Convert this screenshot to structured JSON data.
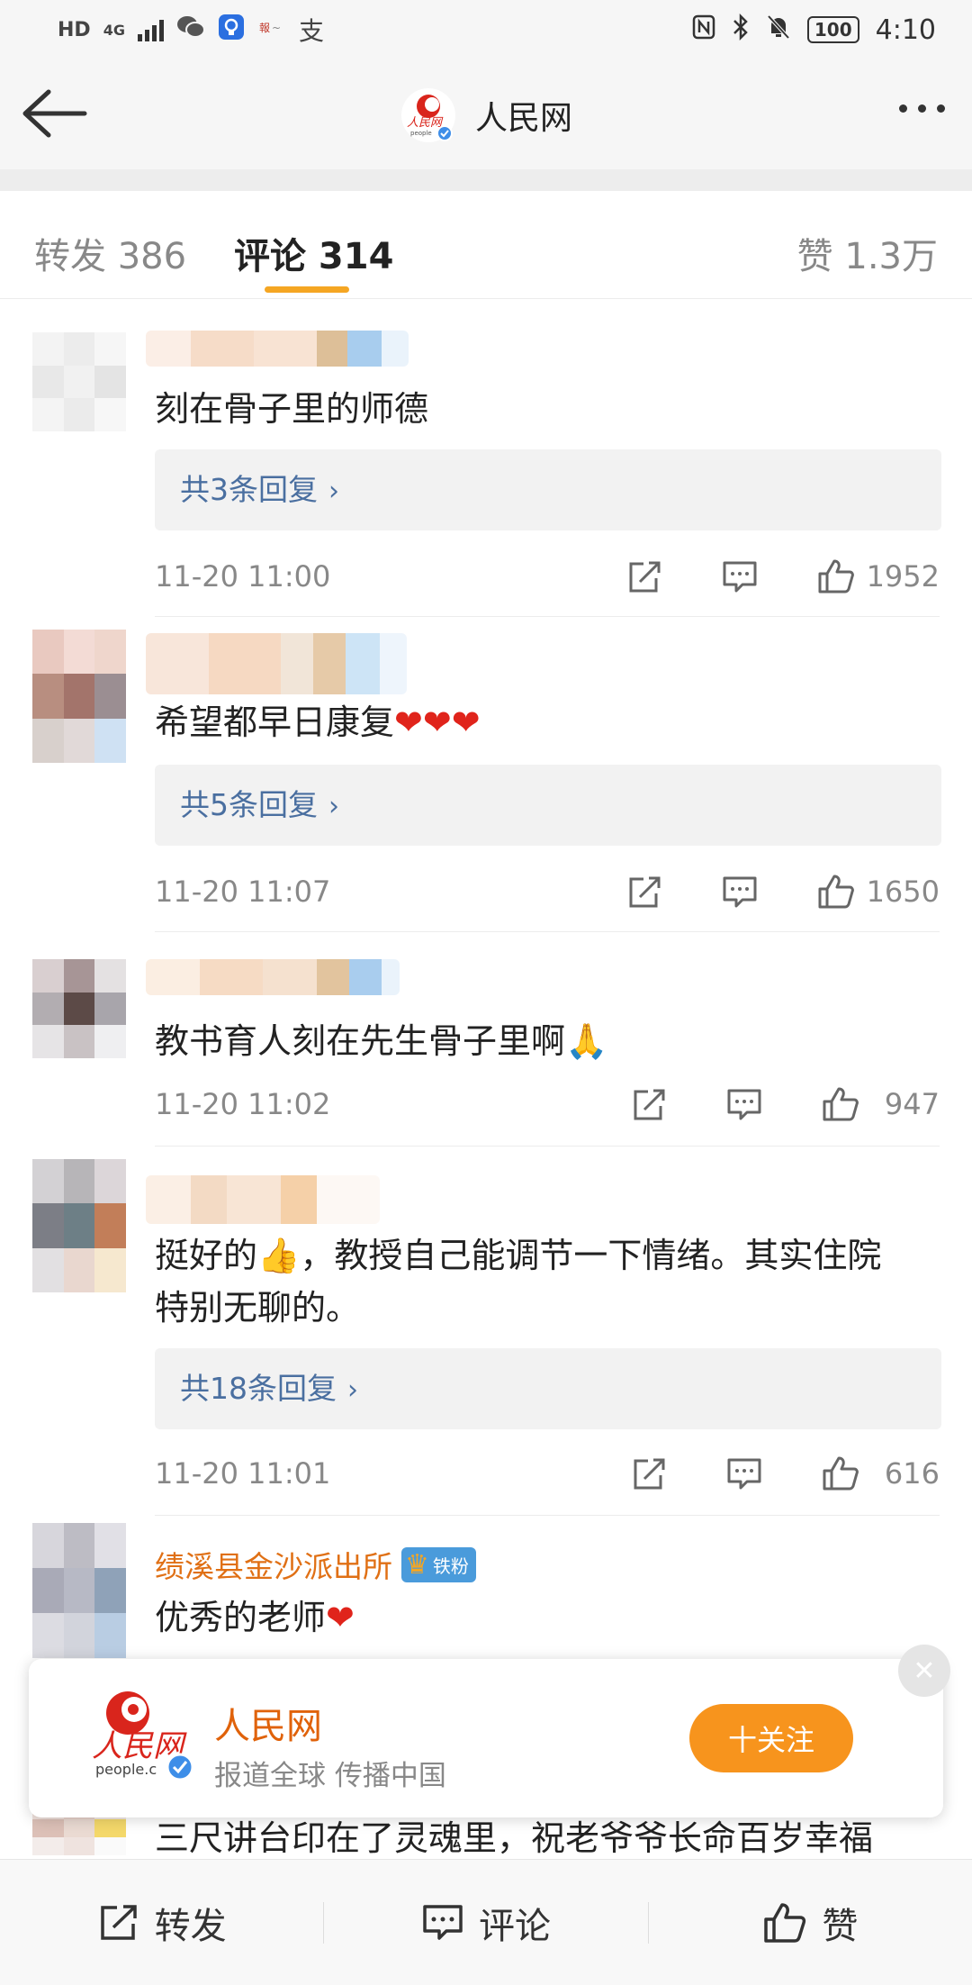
{
  "status_bar": {
    "hd": "HD",
    "net": "4G",
    "battery": "100",
    "time": "4:10"
  },
  "header": {
    "title": "人民网",
    "avatar_text": "人民网",
    "avatar_sub": "people.cn"
  },
  "tabs": {
    "repost": "转发 386",
    "comment": "评论 314",
    "like": "赞 1.3万"
  },
  "comments": [
    {
      "text": "刻在骨子里的师德",
      "reply": "共3条回复",
      "time": "11-20 11:00",
      "likes": "1952"
    },
    {
      "text": "希望都早日康复",
      "hearts": "❤❤❤",
      "reply": "共5条回复",
      "time": "11-20 11:07",
      "likes": "1650"
    },
    {
      "text": "教书育人刻在先生骨子里啊",
      "emoji": "🙏",
      "time": "11-20 11:02",
      "likes": "947"
    },
    {
      "text_a": "挺好的",
      "emoji": "👍",
      "text_b": "，教授自己能调节一下情绪。其实住院",
      "text_line2": "特别无聊的。",
      "reply": "共18条回复",
      "time": "11-20 11:01",
      "likes": "616"
    },
    {
      "username": "绩溪县金沙派出所",
      "badge": "铁粉",
      "text": "优秀的老师",
      "hearts": "❤"
    }
  ],
  "follow_card": {
    "name": "人民网",
    "subtitle": "报道全球 传播中国",
    "logo_text": "人民网",
    "logo_sub": "people.c",
    "button": "十关注"
  },
  "partial_comment": "三尺讲台印在了灵魂里，祝老爷爷长命百岁幸福",
  "bottom_bar": {
    "repost": "转发",
    "comment": "评论",
    "like": "赞"
  },
  "colors": {
    "accent": "#f5a623",
    "link": "#4a6fa0",
    "username": "#e07015",
    "follow_button": "#f7941d"
  }
}
